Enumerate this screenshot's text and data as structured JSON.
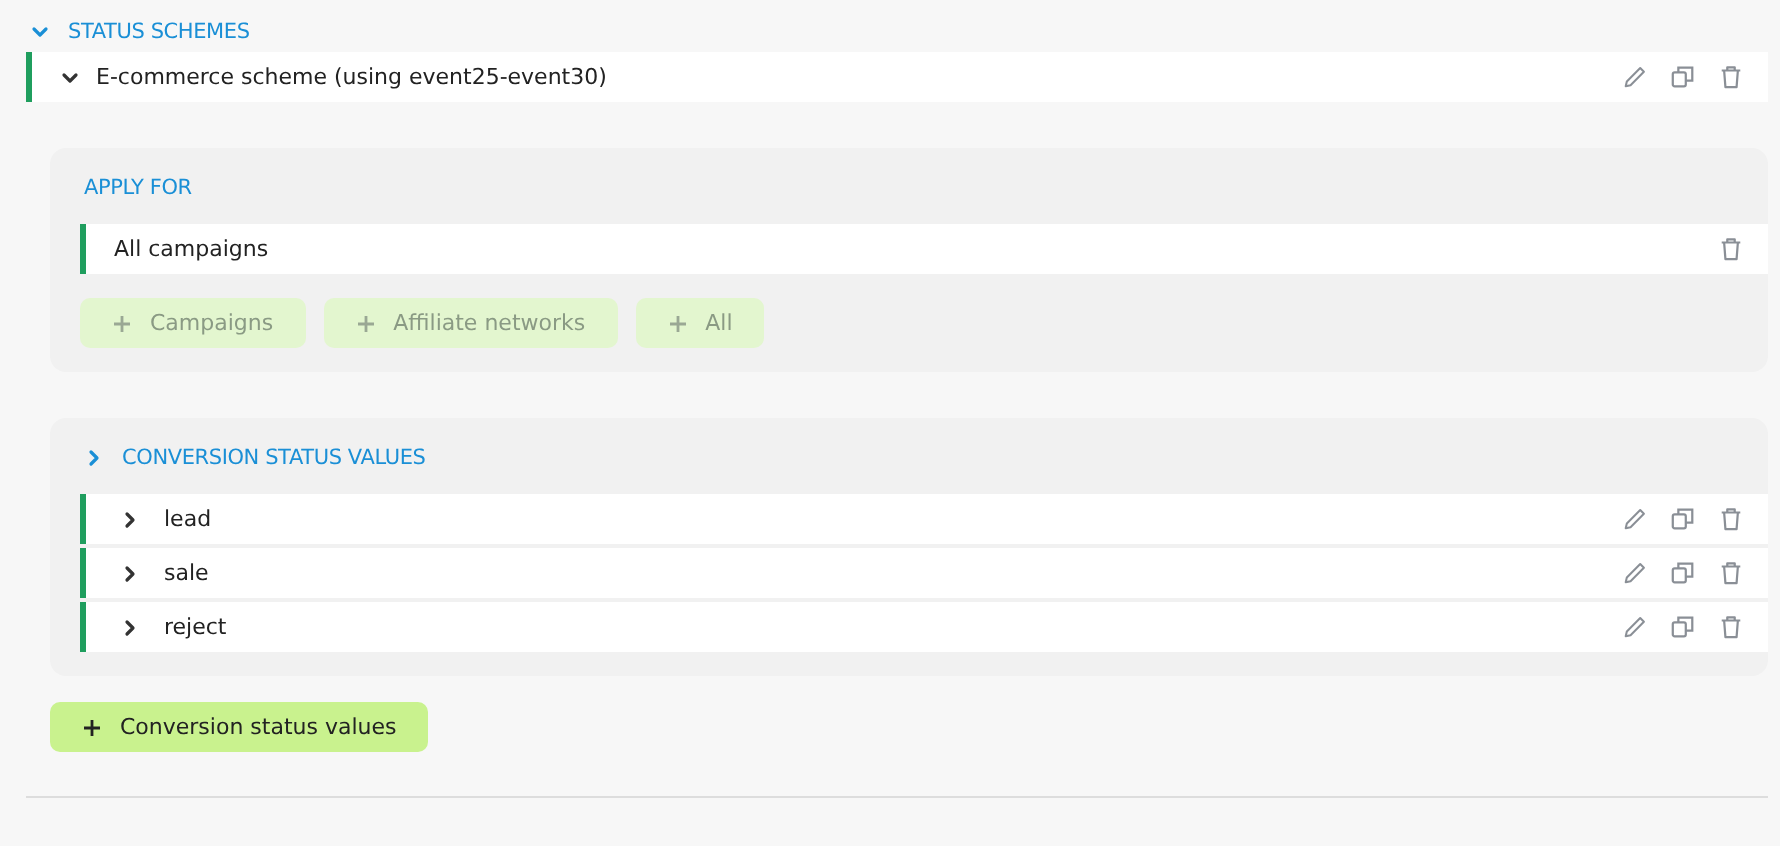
{
  "section": {
    "title": "STATUS SCHEMES",
    "expanded": true
  },
  "scheme": {
    "name": "E-commerce scheme (using event25-event30)",
    "expanded": true
  },
  "apply_for": {
    "title": "APPLY FOR",
    "rows": [
      {
        "label": "All campaigns"
      }
    ],
    "buttons": [
      {
        "label": "Campaigns",
        "disabled": true
      },
      {
        "label": "Affiliate networks",
        "disabled": true
      },
      {
        "label": "All",
        "disabled": true
      }
    ]
  },
  "conversion_status_values": {
    "title": "CONVERSION STATUS VALUES",
    "expanded": false,
    "items": [
      {
        "label": "lead",
        "expanded": false
      },
      {
        "label": "sale",
        "expanded": false
      },
      {
        "label": "reject",
        "expanded": false
      }
    ]
  },
  "add_button": {
    "label": "Conversion status values",
    "disabled": false
  }
}
